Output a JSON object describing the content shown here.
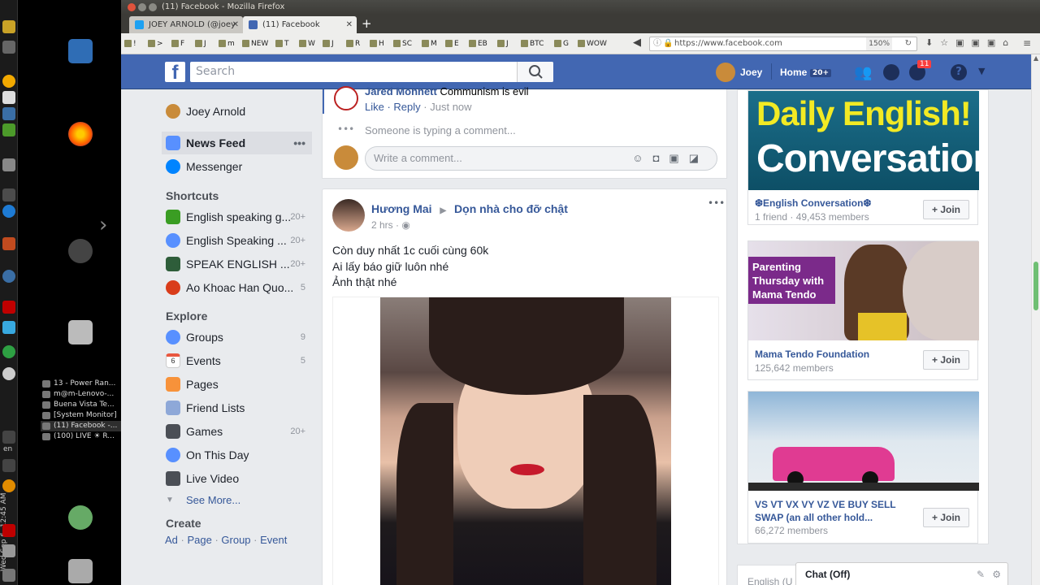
{
  "window": {
    "title": "(11) Facebook - Mozilla Firefox"
  },
  "tabs": [
    {
      "label": "JOEY ARNOLD (@joey",
      "active": false
    },
    {
      "label": "(11) Facebook",
      "active": true
    }
  ],
  "bookmarks": [
    "!",
    ">",
    "F",
    "J",
    "m",
    "NEW",
    "T",
    "W",
    "J",
    "R",
    "H",
    "SC",
    "M",
    "E",
    "EB",
    "J",
    "BTC",
    "G",
    "WOW"
  ],
  "url": {
    "text": "https://www.facebook.com",
    "zoom": "150%"
  },
  "fb": {
    "search_placeholder": "Search",
    "user": "Joey",
    "home": "Home",
    "home_badge": "20+",
    "notif_badge": "11"
  },
  "leftnav": {
    "profile": "Joey Arnold",
    "news_feed": "News Feed",
    "messenger": "Messenger",
    "shortcuts_head": "Shortcuts",
    "shortcuts": [
      {
        "label": "English speaking g...",
        "count": "20+"
      },
      {
        "label": "English Speaking ...",
        "count": "20+"
      },
      {
        "label": "SPEAK ENGLISH ...",
        "count": "20+"
      },
      {
        "label": "Ao Khoac Han Quo...",
        "count": "5"
      }
    ],
    "explore_head": "Explore",
    "explore": [
      {
        "label": "Groups",
        "count": "9"
      },
      {
        "label": "Events",
        "count": "5"
      },
      {
        "label": "Pages",
        "count": ""
      },
      {
        "label": "Friend Lists",
        "count": ""
      },
      {
        "label": "Games",
        "count": "20+"
      },
      {
        "label": "On This Day",
        "count": ""
      },
      {
        "label": "Live Video",
        "count": ""
      }
    ],
    "see_more": "See More...",
    "create_head": "Create",
    "create_links": [
      "Ad",
      "Page",
      "Group",
      "Event"
    ],
    "events_icon_day": "6"
  },
  "comment": {
    "author": "Jared Monnett",
    "text": "Communism is evil",
    "like": "Like",
    "reply": "Reply",
    "time": "Just now",
    "typing": "Someone is typing a comment...",
    "write_placeholder": "Write a comment..."
  },
  "post": {
    "author": "Hương Mai",
    "target": "Dọn nhà cho đỡ chật",
    "time": "2 hrs",
    "lines": [
      "Còn duy nhất 1c cuối cùng 60k",
      "Ai lấy báo giữ luôn nhé",
      "Ảnh thật nhé"
    ]
  },
  "groups": [
    {
      "banner_line1": "Daily English!",
      "banner_line2": "Conversation",
      "name": "❆English Conversation❆",
      "members": "1 friend · 49,453 members",
      "join": "Join"
    },
    {
      "banner_text": "Parenting Thursday with Mama Tendo",
      "name": "Mama Tendo Foundation",
      "members": "125,642 members",
      "join": "Join"
    },
    {
      "name": "VS VT VX VY VZ VE BUY SELL SWAP (an all other hold...",
      "members": "66,272 members",
      "join": "Join"
    }
  ],
  "footer_peek": "English (U",
  "chat": "Chat (Off)",
  "taskbar": {
    "items": [
      "13 - Power Ran...",
      "m@m-Lenovo-...",
      "Buena Vista Te...",
      "[System Monitor]",
      "(11) Facebook -...",
      "(100) LIVE ☀ R..."
    ],
    "clock": "Wed Sep 6, 12:45 AM",
    "lang": "en"
  },
  "colors": {
    "fb_blue": "#4267b2",
    "link": "#365899",
    "badge_red": "#fa3e3e"
  }
}
